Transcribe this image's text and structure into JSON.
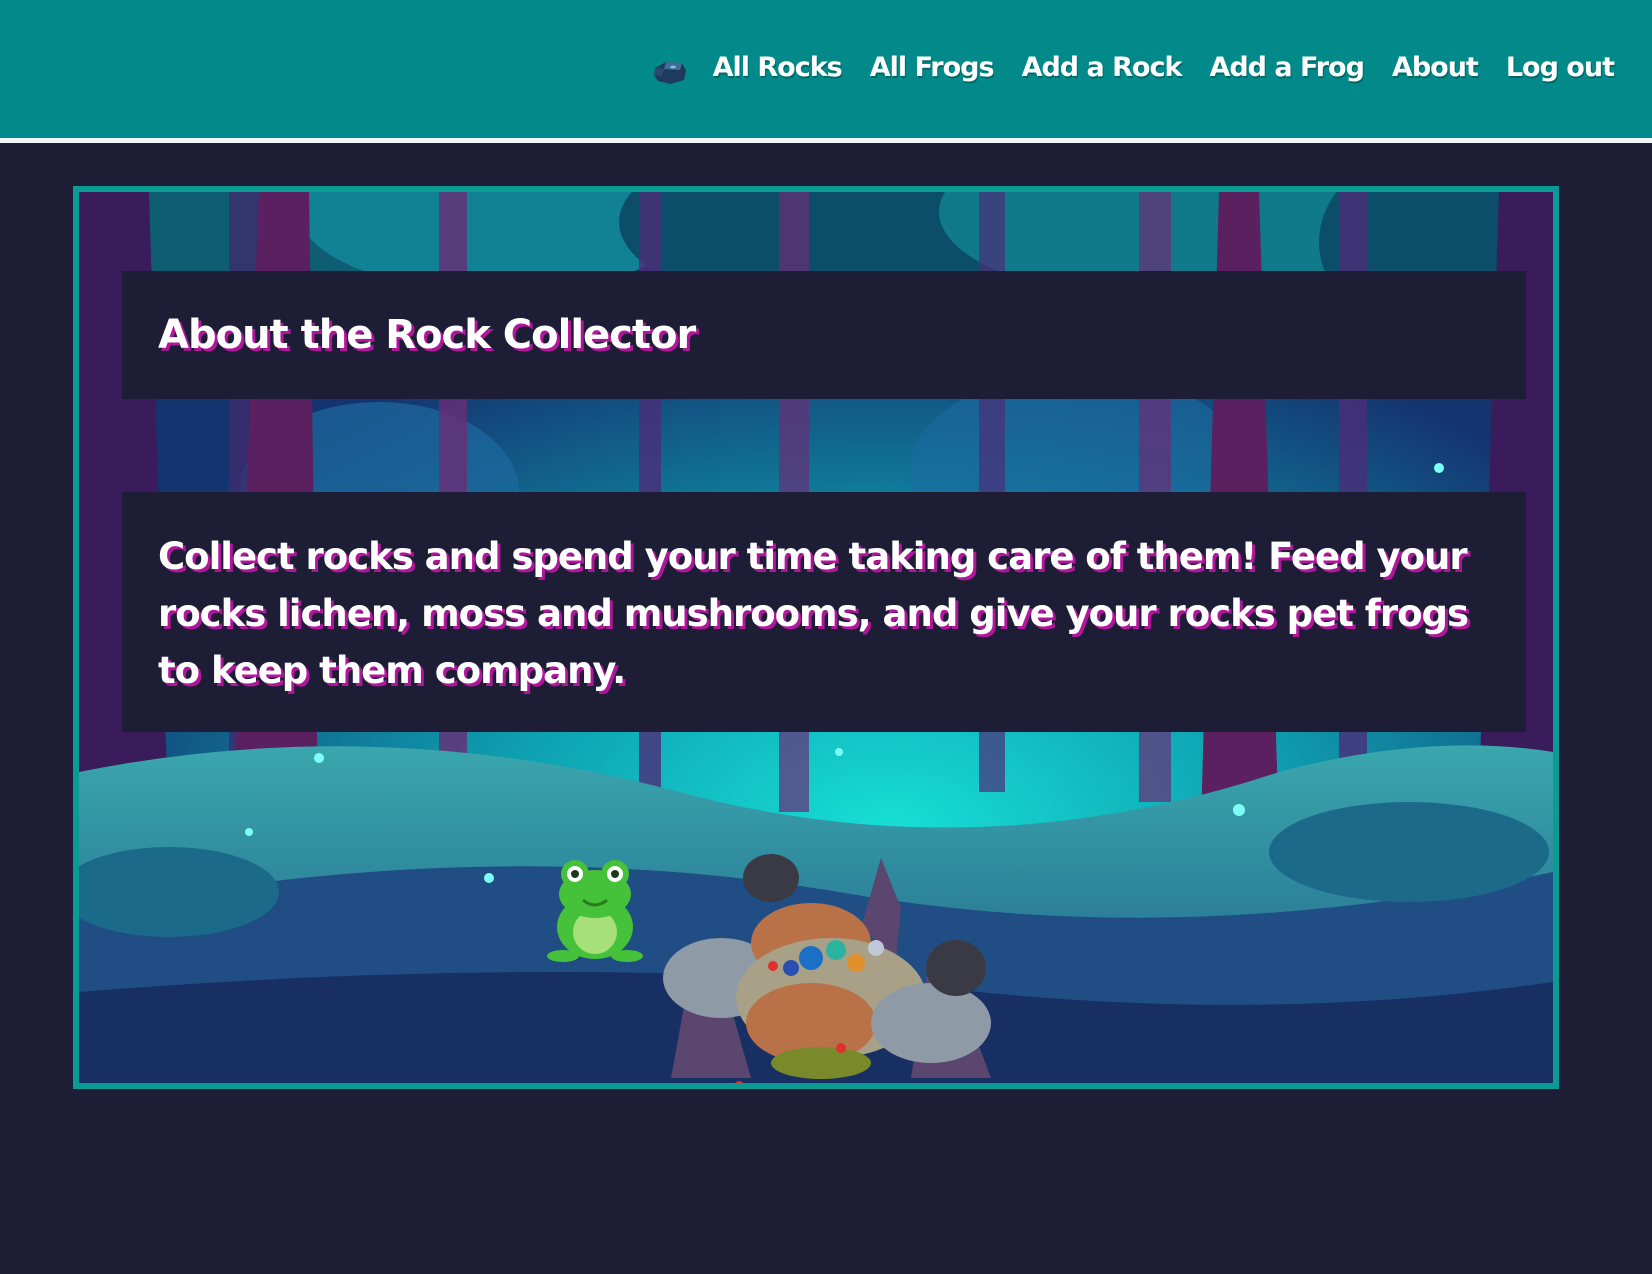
{
  "nav": {
    "logo_icon": "rock-icon",
    "items": [
      {
        "label": "All Rocks"
      },
      {
        "label": "All Frogs"
      },
      {
        "label": "Add a Rock"
      },
      {
        "label": "Add a Frog"
      },
      {
        "label": "About"
      },
      {
        "label": "Log out"
      }
    ]
  },
  "about": {
    "title": "About the Rock Collector",
    "description": "Collect rocks and spend your time taking care of them! Feed your rocks lichen, moss and mushrooms, and give your rocks pet frogs to keep them company."
  },
  "scene": {
    "illustration": "forest-scene",
    "items": [
      "frog-illustration",
      "rock-pile-illustration"
    ]
  },
  "colors": {
    "header": "#028a8a",
    "page_background": "#1d1d35",
    "text_shadow": "#b0169a",
    "frame_border": "#0c9a95"
  }
}
